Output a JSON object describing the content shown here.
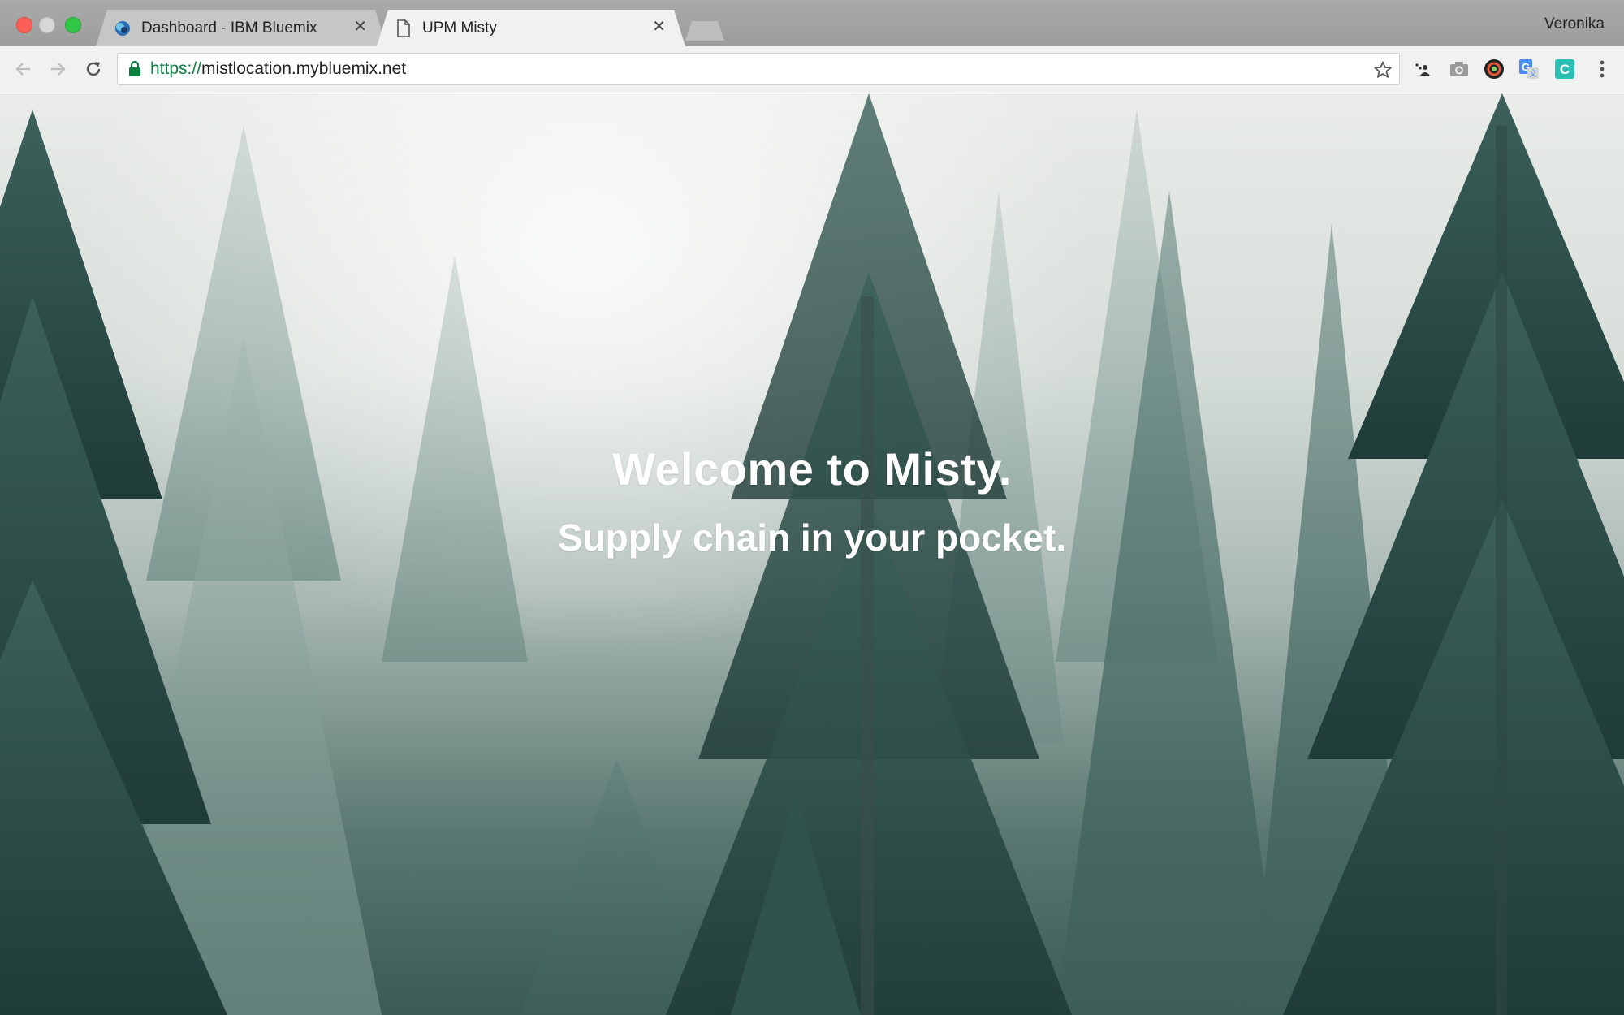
{
  "browser": {
    "profile_name": "Veronika",
    "tabs": [
      {
        "title": "Dashboard - IBM Bluemix",
        "icon": "bluemix-favicon-icon",
        "active": false
      },
      {
        "title": "UPM Misty",
        "icon": "document-icon",
        "active": true
      }
    ],
    "url_scheme": "https://",
    "url_host": "mistlocation.mybluemix.net",
    "extensions": [
      "cast-icon",
      "camera-icon",
      "color-picker-icon",
      "google-translate-icon",
      "c-extension-icon",
      "menu-icon"
    ]
  },
  "page": {
    "title": "Welcome to Misty.",
    "subtitle": "Supply chain in your pocket."
  },
  "colors": {
    "secure_scheme": "#0b8043",
    "hero_text": "#ffffff",
    "forest_dark": "#2c4a45"
  }
}
